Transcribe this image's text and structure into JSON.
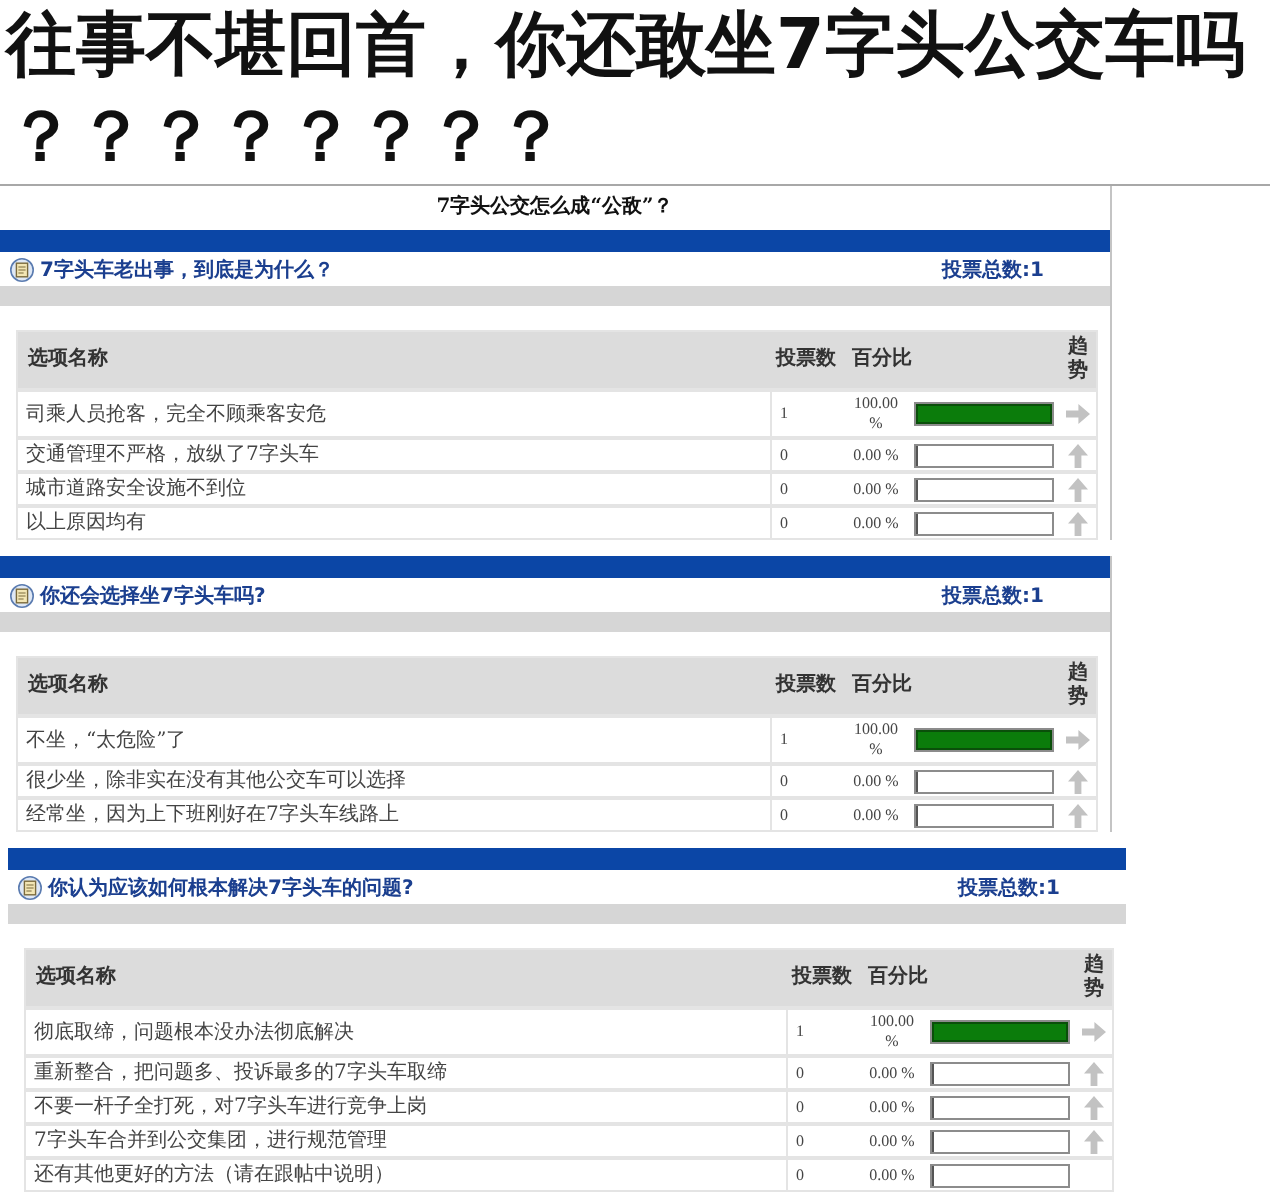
{
  "headline": {
    "lines": [
      "往事不堪回首，你还敢坐7字头公交车吗",
      "？？？？？？？？"
    ]
  },
  "poll": {
    "title": "7字头公交怎么成“公敌”？",
    "sections": [
      {
        "question": "7字头车老出事，到底是为什么？",
        "total": "投票总数:1",
        "columns": [
          "选项名称",
          "投票数",
          "百分比",
          "趋势"
        ],
        "rows": [
          {
            "option": "司乘人员抢客，完全不顾乘客安危",
            "votes": "1",
            "percent": "100.00 %",
            "level": 1,
            "kind": "right"
          },
          {
            "option": "交通管理不严格，放纵了7字头车",
            "votes": "0",
            "percent": "0.00 %",
            "level": 0,
            "kind": "up"
          },
          {
            "option": "城市道路安全设施不到位",
            "votes": "0",
            "percent": "0.00 %",
            "level": 0,
            "kind": "up"
          },
          {
            "option": "以上原因均有",
            "votes": "0",
            "percent": "0.00 %",
            "level": 0,
            "kind": "up"
          }
        ]
      },
      {
        "question": "你还会选择坐7字头车吗?",
        "total": "投票总数:1",
        "columns": [
          "选项名称",
          "投票数",
          "百分比",
          "趋势"
        ],
        "rows": [
          {
            "option": "不坐，“太危险”了",
            "votes": "1",
            "percent": "100.00 %",
            "level": 1,
            "kind": "right"
          },
          {
            "option": "很少坐，除非实在没有其他公交车可以选择",
            "votes": "0",
            "percent": "0.00 %",
            "level": 0,
            "kind": "up"
          },
          {
            "option": "经常坐，因为上下班刚好在7字头车线路上",
            "votes": "0",
            "percent": "0.00 %",
            "level": 0,
            "kind": "up"
          }
        ]
      },
      {
        "question": "你认为应该如何根本解决7字头车的问题?",
        "total": "投票总数:1",
        "columns": [
          "选项名称",
          "投票数",
          "百分比",
          "趋势"
        ],
        "rows": [
          {
            "option": "彻底取缔，问题根本没办法彻底解决",
            "votes": "1",
            "percent": "100.00 %",
            "level": 1,
            "kind": "right"
          },
          {
            "option": "重新整合，把问题多、投诉最多的7字头车取缔",
            "votes": "0",
            "percent": "0.00 %",
            "level": 0,
            "kind": "up"
          },
          {
            "option": "不要一杆子全打死，对7字头车进行竞争上岗",
            "votes": "0",
            "percent": "0.00 %",
            "level": 0,
            "kind": "up"
          },
          {
            "option": "7字头车合并到公交集团，进行规范管理",
            "votes": "0",
            "percent": "0.00 %",
            "level": 0,
            "kind": "up"
          },
          {
            "option": "还有其他更好的方法（请在跟帖中说明）",
            "votes": "0",
            "percent": "0.00 %",
            "level": 0,
            "kind": "plain"
          }
        ]
      }
    ]
  }
}
